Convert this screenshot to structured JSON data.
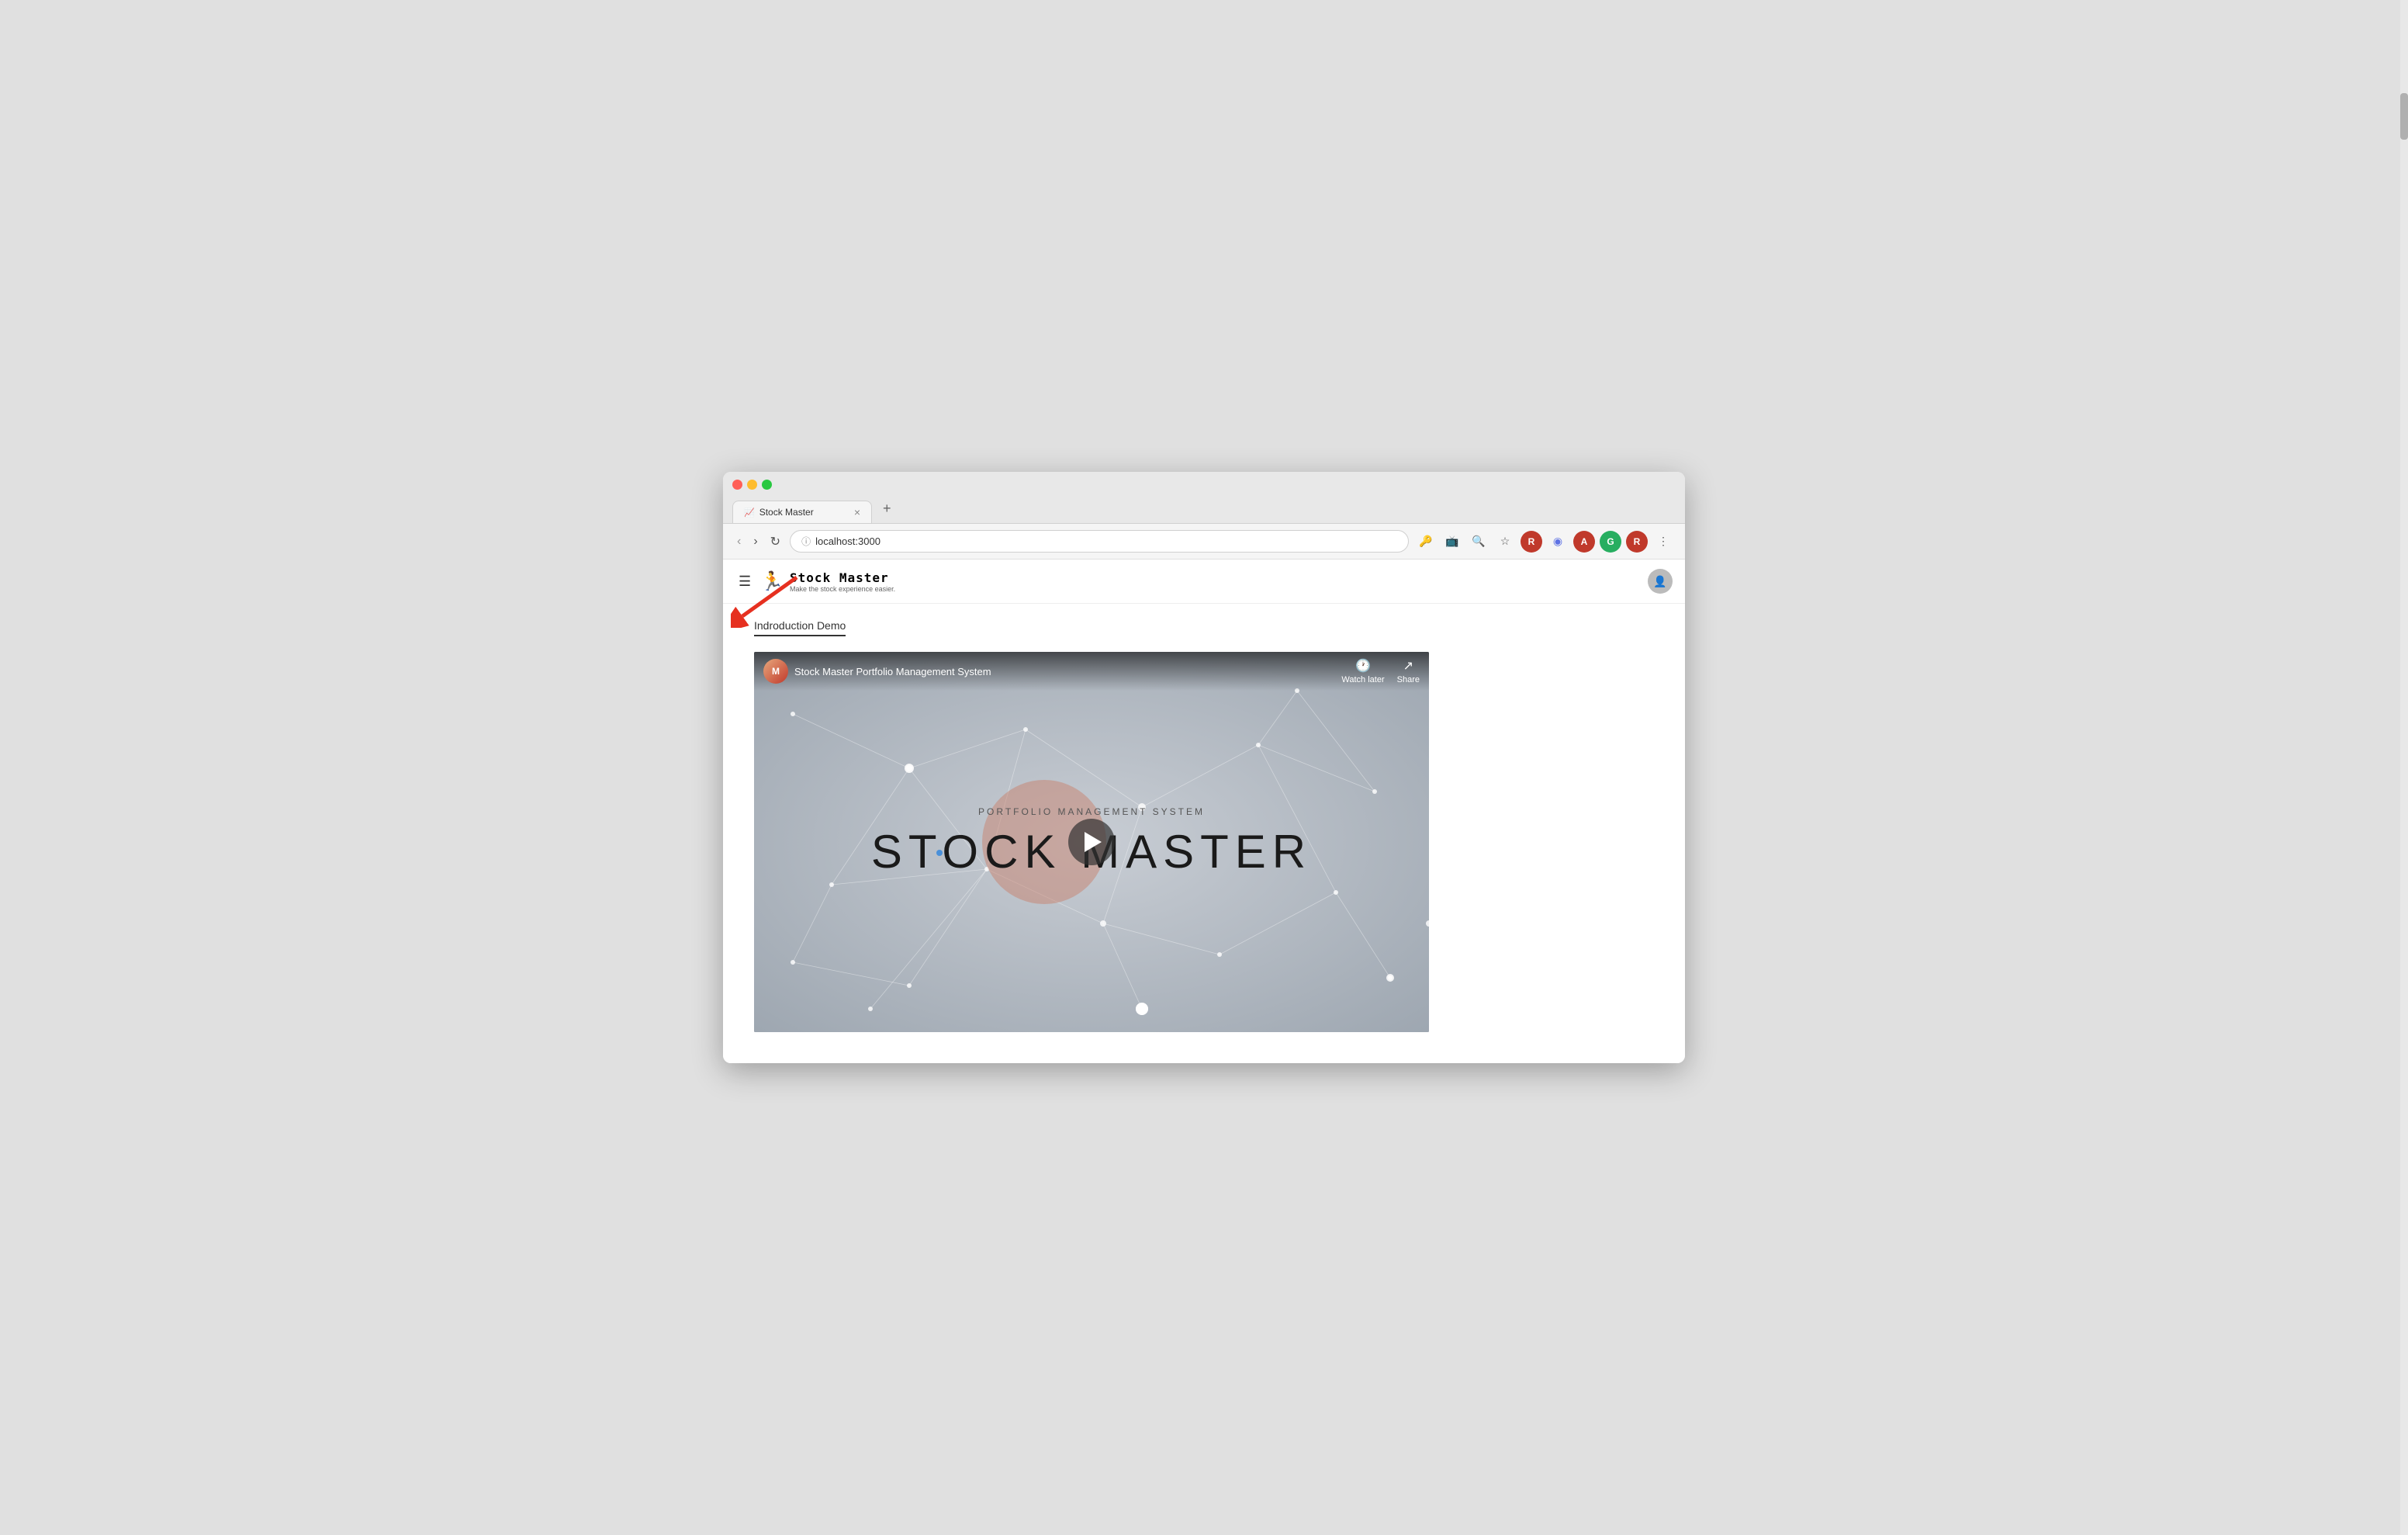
{
  "browser": {
    "tab_title": "Stock Master",
    "tab_favicon": "📈",
    "tab_close": "×",
    "tab_new": "+",
    "address": "localhost:3000",
    "nav": {
      "back": "‹",
      "forward": "›",
      "reload": "↻"
    }
  },
  "app": {
    "hamburger": "☰",
    "brand_name": "Stock Master",
    "brand_tagline": "Make the stock experience easier.",
    "page_title": "Indroduction Demo"
  },
  "video": {
    "title": "Stock Master Portfolio Management System",
    "watch_later": "Watch later",
    "share": "Share",
    "subtitle": "PORTFOLIO MANAGEMENT SYSTEM",
    "main_title": "STOCK MASTER"
  },
  "toolbar": {
    "search": "🔍",
    "star": "☆",
    "more": "⋮",
    "extensions": [
      {
        "label": "R",
        "color": "#c0392b"
      },
      {
        "label": "◉",
        "color": "#5e72e4"
      },
      {
        "label": "A",
        "color": "#c0392b"
      },
      {
        "label": "G",
        "color": "#27ae60"
      }
    ]
  }
}
